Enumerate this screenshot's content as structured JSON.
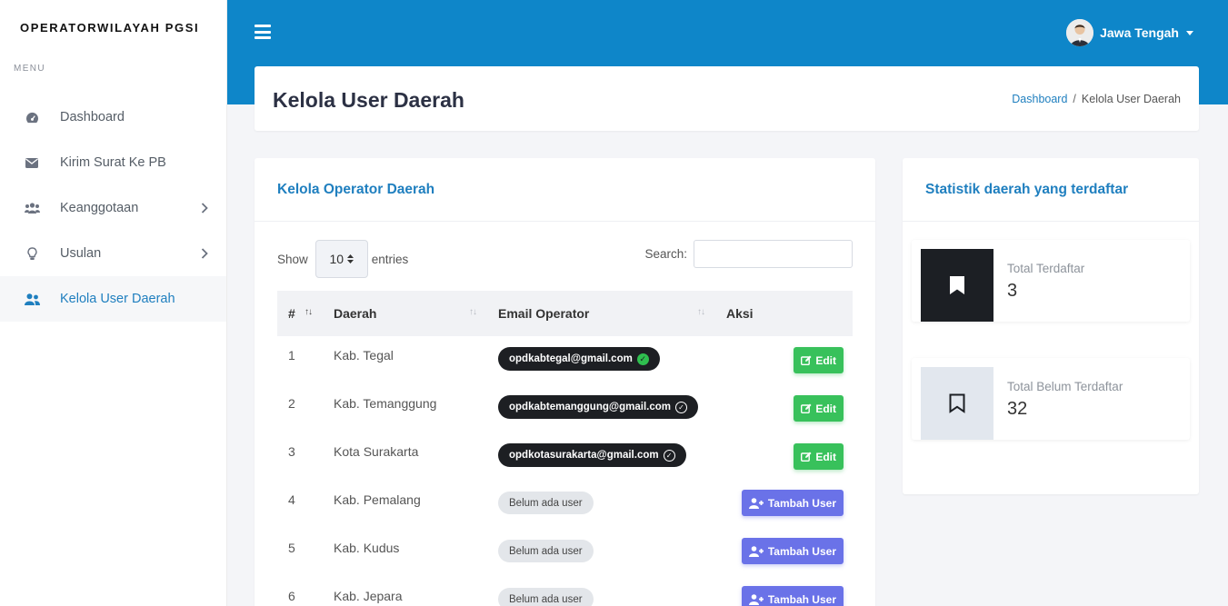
{
  "brand": "OPERATORWILAYAH PGSI",
  "menu_label": "MENU",
  "nav": [
    {
      "label": "Dashboard",
      "icon": "dashboard-icon"
    },
    {
      "label": "Kirim Surat Ke PB",
      "icon": "envelope-icon"
    },
    {
      "label": "Keanggotaan",
      "icon": "users-icon"
    },
    {
      "label": "Usulan",
      "icon": "lightbulb-icon"
    },
    {
      "label": "Kelola User Daerah",
      "icon": "user-group-icon"
    }
  ],
  "header": {
    "user_name": "Jawa Tengah"
  },
  "page": {
    "title": "Kelola User Daerah",
    "breadcrumb": {
      "home": "Dashboard",
      "sep": "/",
      "current": "Kelola User Daerah"
    }
  },
  "operators": {
    "title": "Kelola Operator Daerah",
    "show_label": "Show",
    "entries_value": "10",
    "entries_label": "entries",
    "search_label": "Search:",
    "search_value": "",
    "columns": [
      "#",
      "Daerah",
      "Email Operator",
      "Aksi"
    ],
    "rows": [
      {
        "no": "1",
        "daerah": "Kab. Tegal",
        "email": "opdkabtegal@gmail.com",
        "action": "Edit"
      },
      {
        "no": "2",
        "daerah": "Kab. Temanggung",
        "email": "opdkabtemanggung@gmail.com",
        "action": "Edit"
      },
      {
        "no": "3",
        "daerah": "Kota Surakarta",
        "email": "opdkotasurakarta@gmail.com",
        "action": "Edit"
      },
      {
        "no": "4",
        "daerah": "Kab. Pemalang",
        "email": "Belum ada user",
        "action": "Tambah User"
      },
      {
        "no": "5",
        "daerah": "Kab. Kudus",
        "email": "Belum ada user",
        "action": "Tambah User"
      },
      {
        "no": "6",
        "daerah": "Kab. Jepara",
        "email": "Belum ada user",
        "action": "Tambah User"
      }
    ]
  },
  "stats": {
    "title": "Statistik daerah yang terdaftar",
    "registered_label": "Total Terdaftar",
    "registered_value": "3",
    "unregistered_label": "Total Belum Terdaftar",
    "unregistered_value": "32"
  },
  "colors": {
    "primary": "#0e86c9",
    "link": "#1f7fbf",
    "edit": "#38c15b",
    "add": "#6a72e8"
  }
}
